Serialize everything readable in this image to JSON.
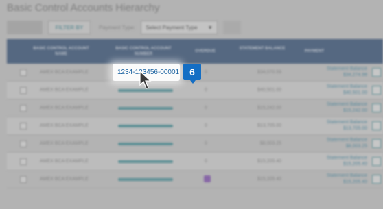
{
  "page": {
    "title": "Basic Control Accounts Hierarchy"
  },
  "toolbar": {
    "filter_label": "FILTER BY",
    "payment_type_label": "Payment Type:",
    "payment_type_select": "Select Payment Type"
  },
  "table": {
    "headers": {
      "account_name": "BASIC CONTROL ACCOUNT NAME",
      "account_number": "BASIC CONTROL ACCOUNT NUMBER",
      "overdue": "OVERDUE",
      "statement_balance": "STATEMENT BALANCE",
      "payment": "PAYMENT"
    },
    "rows": [
      {
        "name": "AMEX BCA EXAMPLE",
        "overdue": "0",
        "balance": "$34,070.59",
        "pay_label": "Statement Balance",
        "pay_amount": "$34,274.98"
      },
      {
        "name": "AMEX BCA EXAMPLE",
        "overdue": "0",
        "balance": "$40,501.00",
        "pay_label": "Statement Balance",
        "pay_amount": "$40,501.00"
      },
      {
        "name": "AMEX BCA EXAMPLE",
        "overdue": "0",
        "balance": "$15,242.00",
        "pay_label": "Statement Balance",
        "pay_amount": "$15,242.00"
      },
      {
        "name": "AMEX BCA EXAMPLE",
        "overdue": "0",
        "balance": "$13,705.00",
        "pay_label": "Statement Balance",
        "pay_amount": "$13,705.00"
      },
      {
        "name": "AMEX BCA EXAMPLE",
        "overdue": "0",
        "balance": "$8,003.25",
        "pay_label": "Statement Balance",
        "pay_amount": "$8,003.25"
      },
      {
        "name": "AMEX BCA EXAMPLE",
        "overdue": "0",
        "balance": "$15,205.40",
        "pay_label": "Statement Balance",
        "pay_amount": "$15,205.40"
      },
      {
        "name": "AMEX BCA EXAMPLE",
        "overdue": "",
        "balance": "$15,205.40",
        "pay_label": "Statement Balance",
        "pay_amount": "$15,205.40"
      }
    ]
  },
  "highlight": {
    "account_number": "1234-123456-00001"
  },
  "step": {
    "number": "6",
    "color": "#146ec4"
  }
}
